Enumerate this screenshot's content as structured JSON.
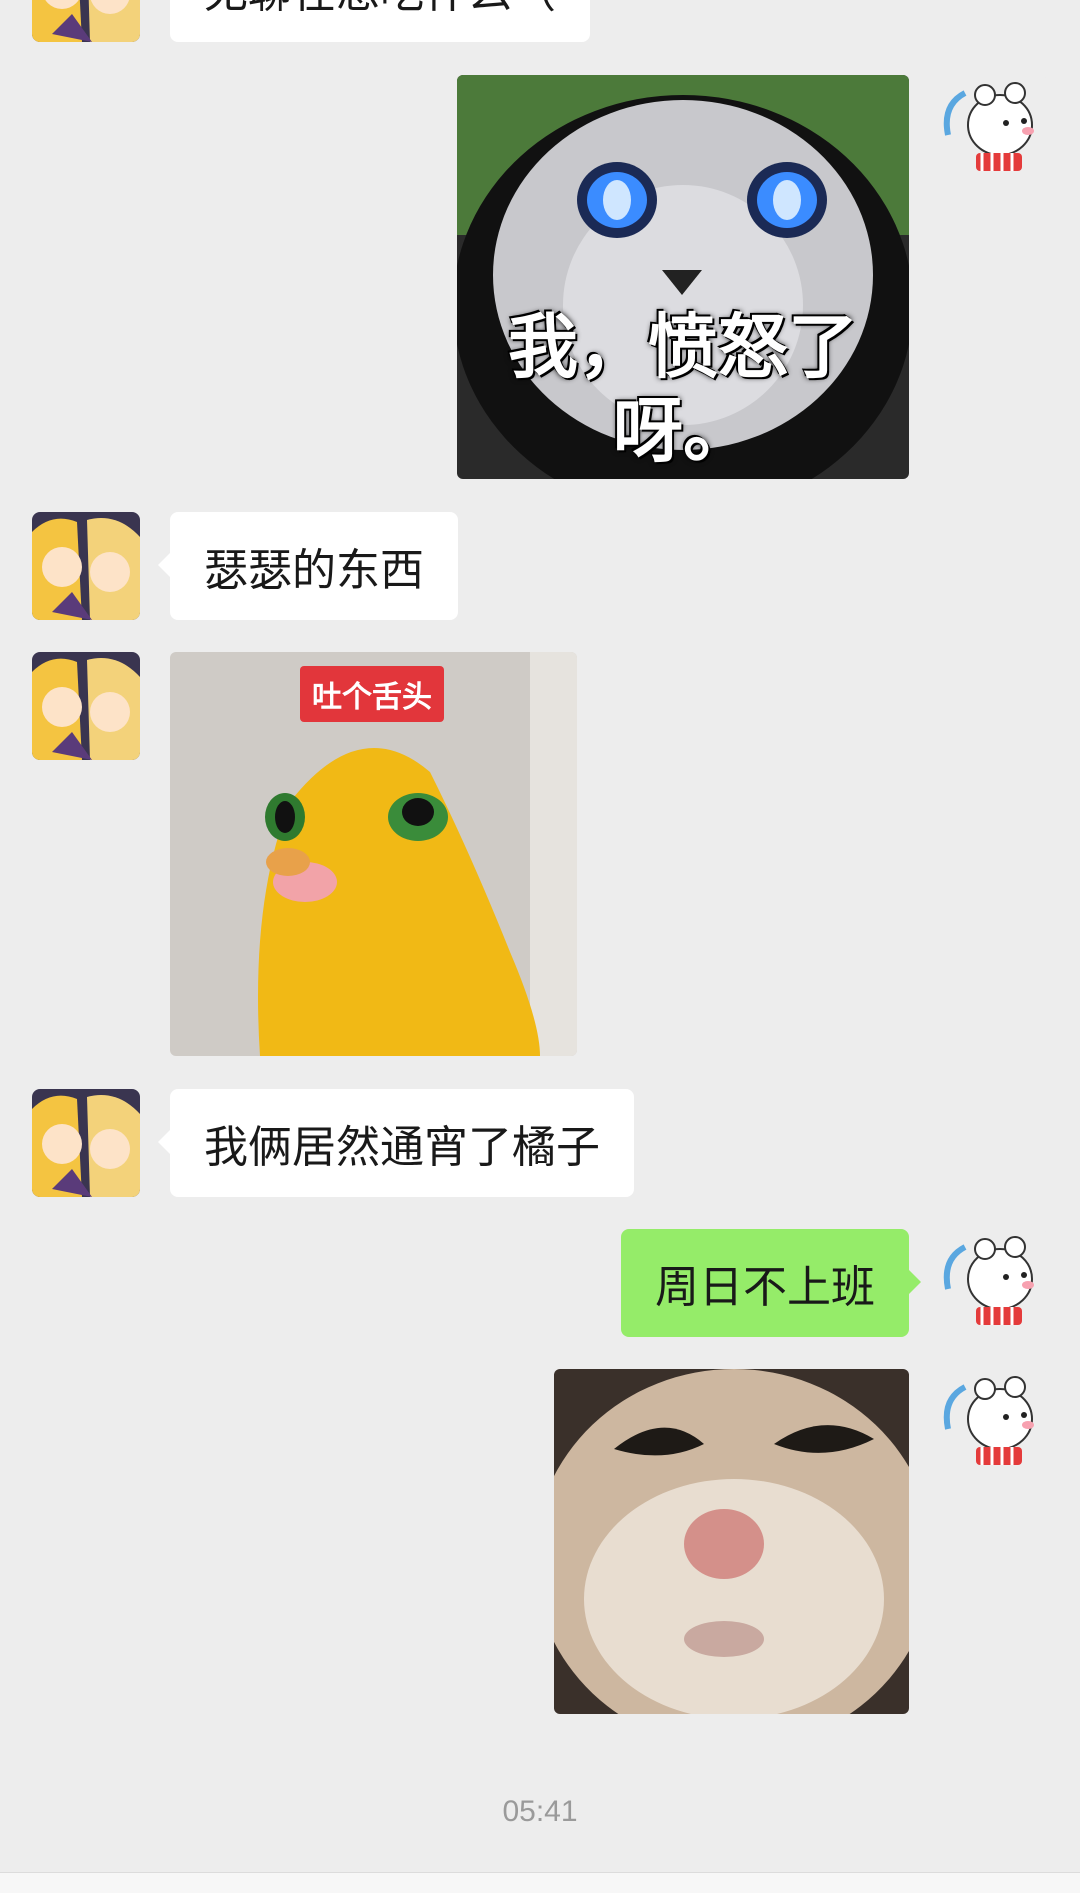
{
  "messages": [
    {
      "sender": "friend",
      "type": "text",
      "text": "无聊在想吃什么（"
    },
    {
      "sender": "me",
      "type": "sticker",
      "caption": "我，愤怒了呀。",
      "description": "cat-blue-eyes-sticker"
    },
    {
      "sender": "friend",
      "type": "text",
      "text": "瑟瑟的东西"
    },
    {
      "sender": "friend",
      "type": "sticker",
      "tag": "吐个舌头",
      "description": "yellow-bird-sticker"
    },
    {
      "sender": "friend",
      "type": "text",
      "text": "我俩居然通宵了橘子"
    },
    {
      "sender": "me",
      "type": "text",
      "text": "周日不上班"
    },
    {
      "sender": "me",
      "type": "image",
      "description": "cat-face-photo"
    }
  ],
  "timestamp": "05:41",
  "colors": {
    "background": "#ededed",
    "outgoing_bubble": "#95ec69",
    "incoming_bubble": "#ffffff"
  },
  "icons": {
    "friend_avatar": "anime-girls-avatar",
    "my_avatar": "white-mouse-avatar"
  }
}
